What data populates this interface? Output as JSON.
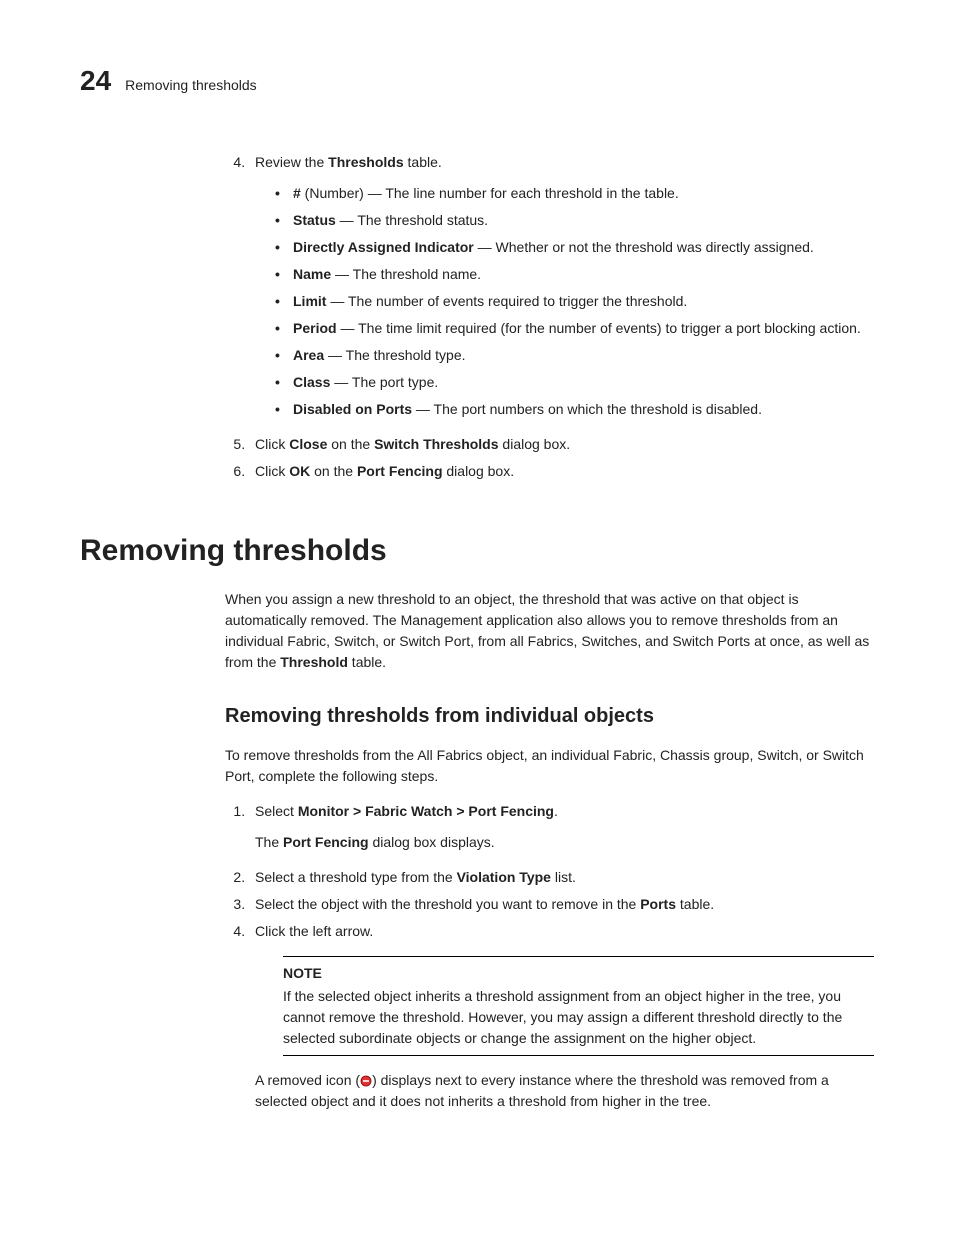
{
  "header": {
    "chapter": "24",
    "crumb": "Removing thresholds"
  },
  "steps1": {
    "s4": {
      "prefix": "Review the ",
      "bold": "Thresholds",
      "suffix": " table."
    },
    "bullets": {
      "b1": {
        "bold": "#",
        "rest": " (Number) — The line number for each threshold in the table."
      },
      "b2": {
        "bold": "Status",
        "rest": " — The threshold status."
      },
      "b3": {
        "bold": "Directly Assigned Indicator",
        "rest": " — Whether or not the threshold was directly assigned."
      },
      "b4": {
        "bold": "Name",
        "rest": " — The threshold name."
      },
      "b5": {
        "bold": "Limit",
        "rest": " — The number of events required to trigger the threshold."
      },
      "b6": {
        "bold": "Period",
        "rest": " — The time limit required (for the number of events) to trigger a port blocking action."
      },
      "b7": {
        "bold": "Area",
        "rest": " — The threshold type."
      },
      "b8": {
        "bold": "Class",
        "rest": " — The port type."
      },
      "b9": {
        "bold": "Disabled on Ports",
        "rest": " — The port numbers on which the threshold is disabled."
      }
    },
    "s5": {
      "t1": "Click ",
      "b1": "Close",
      "t2": " on the ",
      "b2": "Switch Thresholds",
      "t3": " dialog box."
    },
    "s6": {
      "t1": "Click ",
      "b1": "OK",
      "t2": " on the ",
      "b2": "Port Fencing",
      "t3": " dialog box."
    }
  },
  "section": {
    "title": "Removing thresholds",
    "intro": {
      "t1": "When you assign a new threshold to an object, the threshold that was active on that object is automatically removed. The Management application also allows you to remove thresholds from an individual Fabric, Switch, or Switch Port, from all Fabrics, Switches, and Switch Ports at once, as well as from the ",
      "b1": "Threshold",
      "t2": " table."
    },
    "sub": {
      "title": "Removing thresholds from individual objects",
      "intro": "To remove thresholds from the All Fabrics object, an individual Fabric, Chassis group, Switch, or Switch Port, complete the following steps.",
      "s1": {
        "t1": "Select ",
        "b1": "Monitor > Fabric Watch > Port Fencing",
        "t2": "."
      },
      "s1body": {
        "t1": "The ",
        "b1": "Port Fencing",
        "t2": " dialog box displays."
      },
      "s2": {
        "t1": "Select a threshold type from the ",
        "b1": "Violation Type",
        "t2": " list."
      },
      "s3": {
        "t1": "Select the object with the threshold you want to remove in the ",
        "b1": "Ports",
        "t2": " table."
      },
      "s4": "Click the left arrow.",
      "note": {
        "title": "NOTE",
        "body": "If the selected object inherits a threshold assignment from an object higher in the tree, you cannot remove the threshold. However, you may assign a different threshold directly to the selected subordinate objects or change the assignment on the higher object."
      },
      "after": {
        "t1": "A removed icon (",
        "t2": ") displays next to every instance where the threshold was removed from a selected object and it does not inherits a threshold from higher in the tree."
      }
    }
  }
}
